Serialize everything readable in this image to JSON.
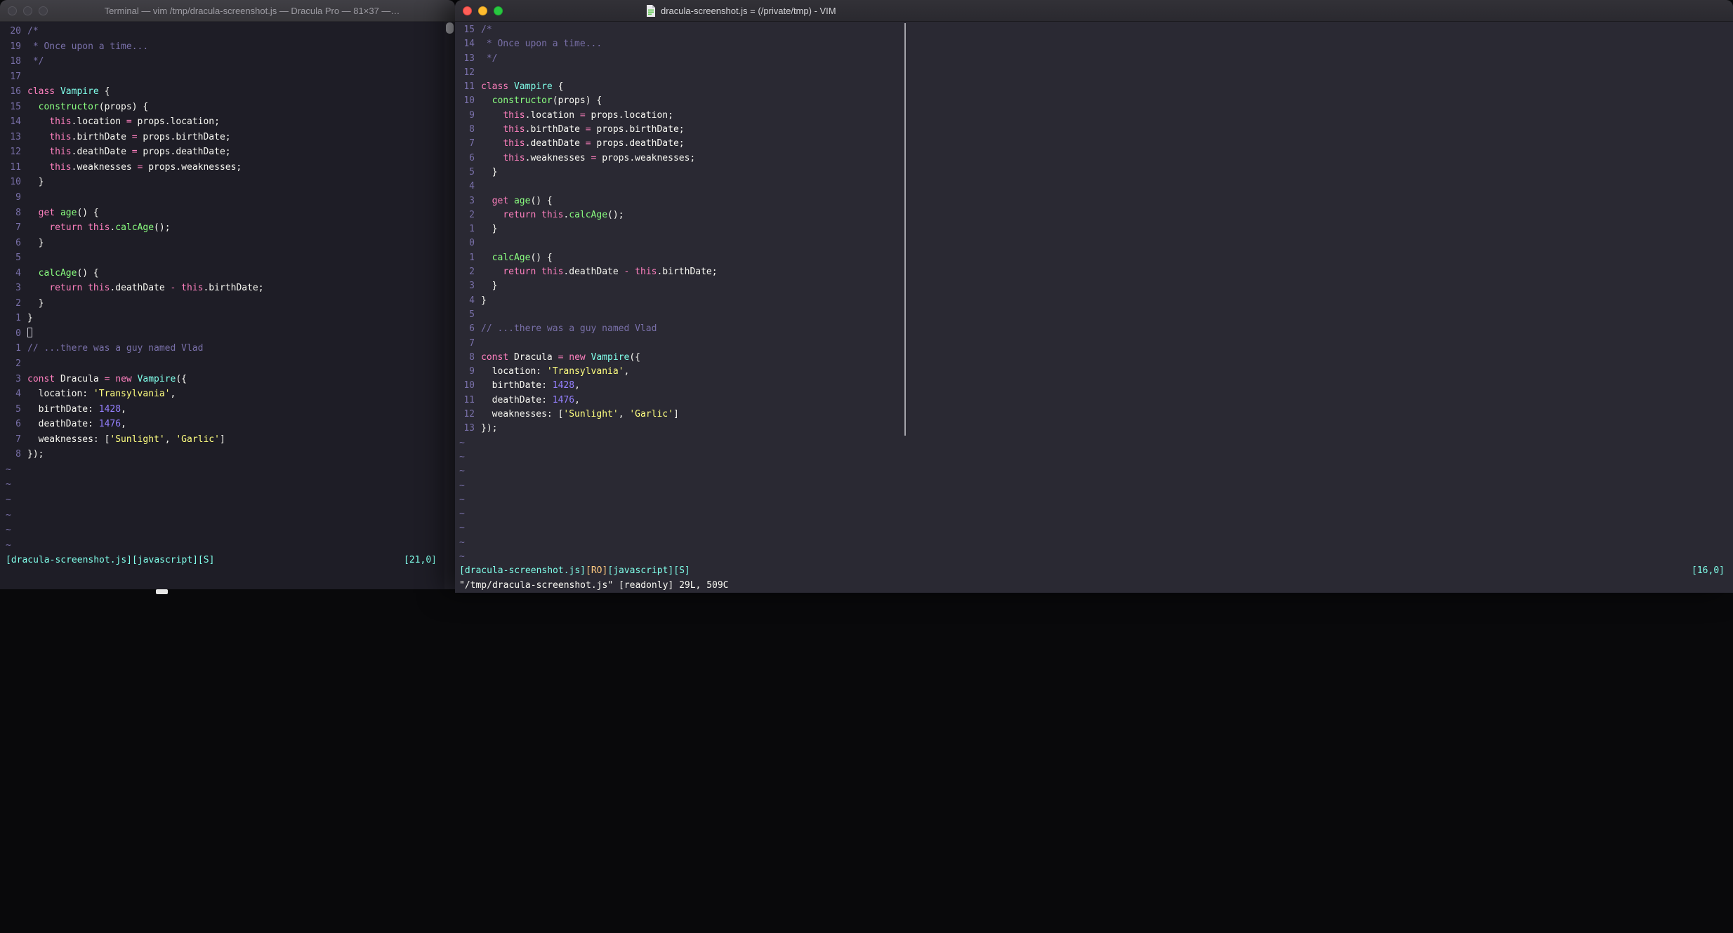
{
  "palette": {
    "fg": "#f8f8f2",
    "comment": "#7970a9",
    "pink": "#ff80bf",
    "green": "#8aff80",
    "cyan": "#80ffea",
    "yellow": "#ffff80",
    "purple": "#9580ff",
    "orange": "#ffca80",
    "line_number": "#7970a9"
  },
  "code_lines": [
    [
      [
        "comment",
        "/*"
      ]
    ],
    [
      [
        "comment",
        " * Once upon a time..."
      ]
    ],
    [
      [
        "comment",
        " */"
      ]
    ],
    [],
    [
      [
        "pink",
        "class"
      ],
      [
        "fg",
        " "
      ],
      [
        "cyan",
        "Vampire"
      ],
      [
        "fg",
        " {"
      ]
    ],
    [
      [
        "fg",
        "  "
      ],
      [
        "green",
        "constructor"
      ],
      [
        "fg",
        "(props) {"
      ]
    ],
    [
      [
        "fg",
        "    "
      ],
      [
        "pink",
        "this"
      ],
      [
        "fg",
        ".location "
      ],
      [
        "pink",
        "="
      ],
      [
        "fg",
        " props.location;"
      ]
    ],
    [
      [
        "fg",
        "    "
      ],
      [
        "pink",
        "this"
      ],
      [
        "fg",
        ".birthDate "
      ],
      [
        "pink",
        "="
      ],
      [
        "fg",
        " props.birthDate;"
      ]
    ],
    [
      [
        "fg",
        "    "
      ],
      [
        "pink",
        "this"
      ],
      [
        "fg",
        ".deathDate "
      ],
      [
        "pink",
        "="
      ],
      [
        "fg",
        " props.deathDate;"
      ]
    ],
    [
      [
        "fg",
        "    "
      ],
      [
        "pink",
        "this"
      ],
      [
        "fg",
        ".weaknesses "
      ],
      [
        "pink",
        "="
      ],
      [
        "fg",
        " props.weaknesses;"
      ]
    ],
    [
      [
        "fg",
        "  }"
      ]
    ],
    [],
    [
      [
        "fg",
        "  "
      ],
      [
        "pink",
        "get"
      ],
      [
        "fg",
        " "
      ],
      [
        "green",
        "age"
      ],
      [
        "fg",
        "() {"
      ]
    ],
    [
      [
        "fg",
        "    "
      ],
      [
        "pink",
        "return"
      ],
      [
        "fg",
        " "
      ],
      [
        "pink",
        "this"
      ],
      [
        "fg",
        "."
      ],
      [
        "green",
        "calcAge"
      ],
      [
        "fg",
        "();"
      ]
    ],
    [
      [
        "fg",
        "  }"
      ]
    ],
    [],
    [
      [
        "fg",
        "  "
      ],
      [
        "green",
        "calcAge"
      ],
      [
        "fg",
        "() {"
      ]
    ],
    [
      [
        "fg",
        "    "
      ],
      [
        "pink",
        "return"
      ],
      [
        "fg",
        " "
      ],
      [
        "pink",
        "this"
      ],
      [
        "fg",
        ".deathDate "
      ],
      [
        "pink",
        "-"
      ],
      [
        "fg",
        " "
      ],
      [
        "pink",
        "this"
      ],
      [
        "fg",
        ".birthDate;"
      ]
    ],
    [
      [
        "fg",
        "  }"
      ]
    ],
    [
      [
        "fg",
        "}"
      ]
    ],
    [],
    [
      [
        "comment",
        "// ...there was a guy named Vlad"
      ]
    ],
    [],
    [
      [
        "pink",
        "const"
      ],
      [
        "fg",
        " Dracula "
      ],
      [
        "pink",
        "="
      ],
      [
        "fg",
        " "
      ],
      [
        "pink",
        "new"
      ],
      [
        "fg",
        " "
      ],
      [
        "cyan",
        "Vampire"
      ],
      [
        "fg",
        "({"
      ]
    ],
    [
      [
        "fg",
        "  location: "
      ],
      [
        "yellow",
        "'Transylvania'"
      ],
      [
        "fg",
        ","
      ]
    ],
    [
      [
        "fg",
        "  birthDate: "
      ],
      [
        "purple",
        "1428"
      ],
      [
        "fg",
        ","
      ]
    ],
    [
      [
        "fg",
        "  deathDate: "
      ],
      [
        "purple",
        "1476"
      ],
      [
        "fg",
        ","
      ]
    ],
    [
      [
        "fg",
        "  weaknesses: ["
      ],
      [
        "yellow",
        "'Sunlight'"
      ],
      [
        "fg",
        ", "
      ],
      [
        "yellow",
        "'Garlic'"
      ],
      [
        "fg",
        "]"
      ]
    ],
    [
      [
        "fg",
        "});"
      ]
    ]
  ],
  "left_window": {
    "title": "Terminal — vim /tmp/dracula-screenshot.js — Dracula Pro — 81×37 —…",
    "relative_numbers": [
      20,
      19,
      18,
      17,
      16,
      15,
      14,
      13,
      12,
      11,
      10,
      9,
      8,
      7,
      6,
      5,
      4,
      3,
      2,
      1,
      0,
      1,
      2,
      3,
      4,
      5,
      6,
      7,
      8
    ],
    "cursor_row": 20,
    "cursor": "hollow",
    "tildes": 6,
    "status_segments": [
      [
        "cyan",
        "[dracula-screenshot.js][javascript][S]"
      ]
    ],
    "status_right": "[21,0]",
    "ex_line": ""
  },
  "right_window": {
    "title": "dracula-screenshot.js = (/private/tmp) - VIM",
    "relative_numbers": [
      15,
      14,
      13,
      12,
      11,
      10,
      9,
      8,
      7,
      6,
      5,
      4,
      3,
      2,
      1,
      0,
      1,
      2,
      3,
      4,
      5,
      6,
      7,
      8,
      9,
      10,
      11,
      12,
      13
    ],
    "cursor_row": 15,
    "cursor": "",
    "tildes": 9,
    "status_segments": [
      [
        "cyan",
        "[dracula-screenshot.js]"
      ],
      [
        "orange",
        "[RO]"
      ],
      [
        "cyan",
        "[javascript][S]"
      ]
    ],
    "status_right": "[16,0]",
    "ex_line": "\"/tmp/dracula-screenshot.js\" [readonly] 29L, 509C"
  }
}
